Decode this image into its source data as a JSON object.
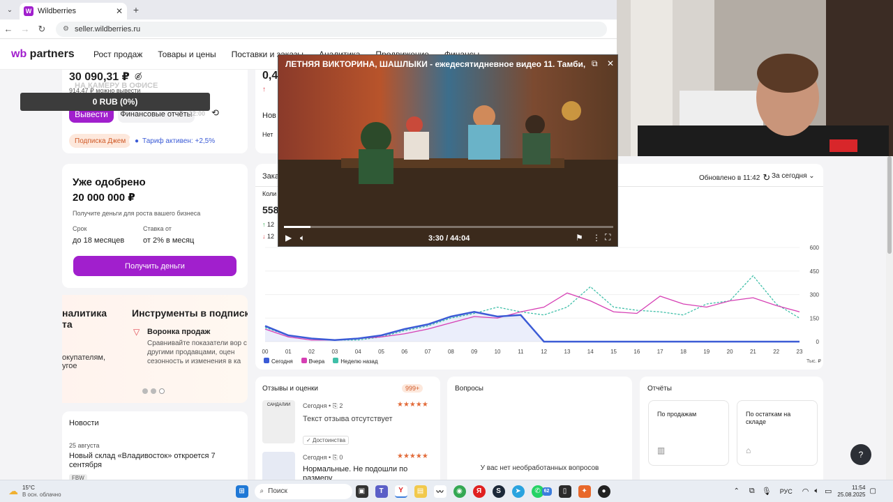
{
  "browser": {
    "tab_title": "Wildberries",
    "tab_favicon": "W",
    "url": "seller.wildberries.ru"
  },
  "header": {
    "logo_a": "wb",
    "logo_b": "partners",
    "nav": [
      "Рост продаж",
      "Товары и цены",
      "Поставки и заказы",
      "Аналитика",
      "Продвижение",
      "Финансы"
    ]
  },
  "balance": {
    "amount": "30 090,31 ₽",
    "sub": "914,47 ₽ можно вывести",
    "ghost_label": "НА КАМЕРУ В ОФИСЕ",
    "tooltip": "0 RUB (0%)",
    "withdraw_label": "Вывести",
    "finance_label": "Финансовые отчёты",
    "ghost_time": "12:00",
    "chip_sub": "Подписка Джем",
    "chip_tariff": "Тариф активен: +2,5%"
  },
  "loan": {
    "title1": "Уже одобрено",
    "title2": "20 000 000 ₽",
    "desc": "Получите деньги для роста вашего бизнеса",
    "term_label": "Срок",
    "term_value": "до 18 месяцев",
    "rate_label": "Ставка от",
    "rate_value": "от 2% в месяц",
    "button": "Получить деньги"
  },
  "promo": {
    "left_title1": "налитика",
    "left_title2": "та",
    "left_text1": "окупателям,",
    "left_text2": "угое",
    "right_title": "Инструменты в подписк",
    "item_title": "Воронка продаж",
    "item_text": "Сравнивайте показатели вор с другими продавцами, оцен сезонность и изменения в ка"
  },
  "news": {
    "title": "Новости",
    "date": "25 августа",
    "headline": "Новый склад «Владивосток» откроется 7 сентября",
    "tag": "FBW"
  },
  "stats_top": {
    "value_partial": "0,4",
    "arrow": "↑",
    "nov": "Нов",
    "no": "Нет"
  },
  "orders": {
    "title_partial": "Зака",
    "count_label": "Коли",
    "count_value": "558",
    "up_value": "12",
    "down_value": "12",
    "updated": "Обновлено в 11:42",
    "period": "За сегодня",
    "currency_unit": "Тыс. ₽"
  },
  "chart_data": {
    "type": "line",
    "x": [
      "00",
      "01",
      "02",
      "03",
      "04",
      "05",
      "06",
      "07",
      "08",
      "09",
      "10",
      "11",
      "12",
      "13",
      "14",
      "15",
      "16",
      "17",
      "18",
      "19",
      "20",
      "21",
      "22",
      "23"
    ],
    "yticks": [
      0,
      150,
      300,
      450,
      600
    ],
    "ylim": [
      0,
      600
    ],
    "series": [
      {
        "name": "Сегодня",
        "color": "#3b5bd6",
        "values": [
          100,
          40,
          20,
          10,
          20,
          40,
          80,
          110,
          160,
          190,
          160,
          170,
          0,
          0,
          0,
          0,
          0,
          0,
          0,
          0,
          0,
          0,
          0,
          0
        ]
      },
      {
        "name": "Вчера",
        "color": "#d63fb4",
        "values": [
          80,
          30,
          10,
          10,
          20,
          30,
          50,
          80,
          120,
          160,
          150,
          190,
          220,
          310,
          260,
          190,
          180,
          290,
          240,
          220,
          260,
          280,
          230,
          190
        ]
      },
      {
        "name": "Неделю назад",
        "color": "#3fbfa8",
        "values": [
          90,
          40,
          20,
          10,
          10,
          30,
          70,
          100,
          150,
          180,
          220,
          190,
          170,
          220,
          350,
          220,
          200,
          190,
          170,
          240,
          260,
          420,
          240,
          150
        ]
      }
    ],
    "fill_series": "Сегодня"
  },
  "reviews": {
    "title": "Отзывы и оценки",
    "badge": "999+",
    "r1_when": "Сегодня",
    "r1_clips": "2",
    "r1_text": "Текст отзыва отсутствует",
    "r1_tag": "Достоинства",
    "r1_stars": "★★★★★",
    "r1_thumb": "САНДАЛИИ",
    "r2_when": "Сегодня",
    "r2_clips": "0",
    "r2_text": "Нормальные. Не подошли по размеру",
    "r2_stars": "★★★★★"
  },
  "questions": {
    "title": "Вопросы",
    "empty": "У вас нет необработанных вопросов"
  },
  "reports": {
    "title": "Отчёты",
    "r1": "По продажам",
    "r2": "По остаткам на складе"
  },
  "video": {
    "title": "ЛЕТНЯЯ ВИКТОРИНА, ШАШЛЫКИ - ежедесятидневное видео 11. Тамби, ...",
    "time": "3:30 / 44:04",
    "progress": 0.08
  },
  "taskbar": {
    "temp": "15°C",
    "weather": "В осн. облачно",
    "search": "Поиск",
    "lang": "РУС",
    "time": "11:54",
    "date": "25.08.2025",
    "badge_a": "62",
    "badge_b": "25"
  },
  "help": "?"
}
